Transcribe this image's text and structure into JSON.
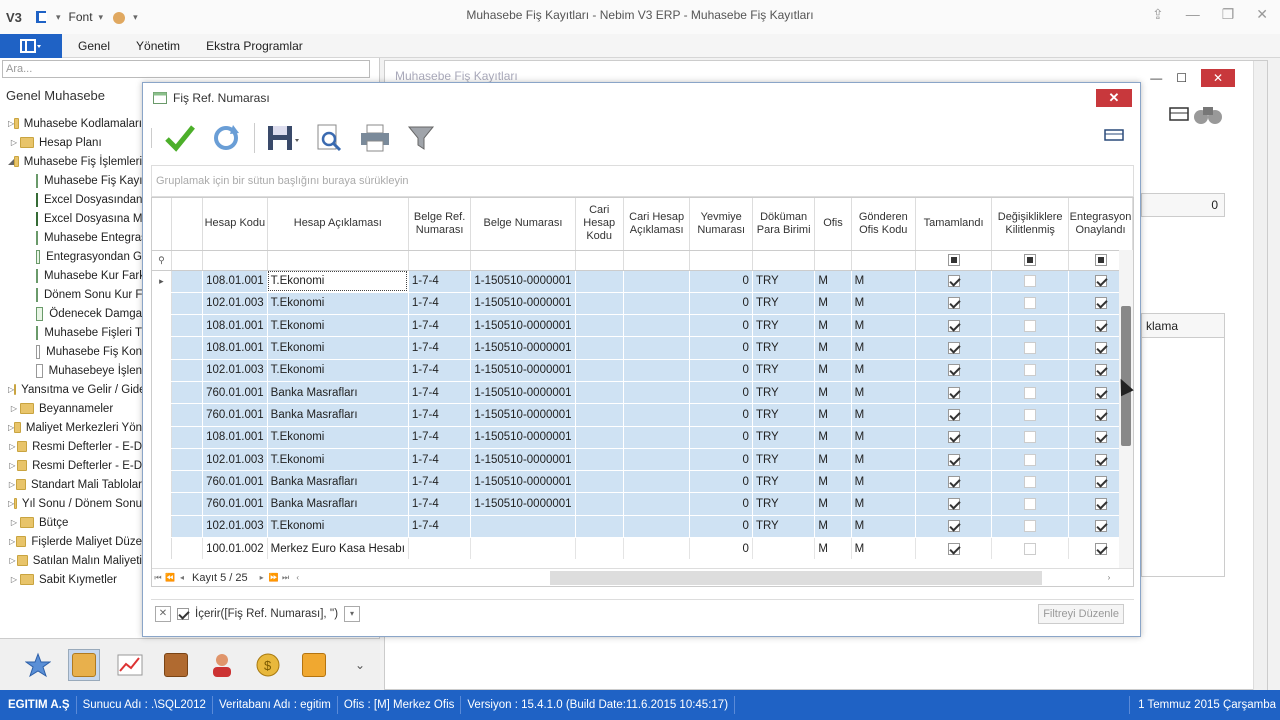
{
  "window": {
    "title": "Muhasebe Fiş Kayıtları - Nebim V3 ERP - Muhasebe Fiş Kayıtları",
    "logo": "V3",
    "quick_access_font": "Font"
  },
  "menu": {
    "items": [
      "Genel",
      "Yönetim",
      "Ekstra Programlar"
    ]
  },
  "sidebar": {
    "search_placeholder": "Ara...",
    "header": "Genel Muhasebe",
    "tree": [
      {
        "label": "Muhasebe Kodlamaları",
        "type": "folder",
        "level": 0,
        "expanded": false
      },
      {
        "label": "Hesap Planı",
        "type": "folder",
        "level": 0,
        "expanded": false
      },
      {
        "label": "Muhasebe Fiş İşlemleri",
        "type": "folder",
        "level": 0,
        "expanded": true
      },
      {
        "label": "Muhasebe Fiş Kayıtları",
        "type": "doc",
        "level": 1
      },
      {
        "label": "Excel Dosyasından",
        "type": "xls",
        "level": 1
      },
      {
        "label": "Excel Dosyasına M",
        "type": "xls",
        "level": 1
      },
      {
        "label": "Muhasebe Entegrasyon",
        "type": "doc",
        "level": 1
      },
      {
        "label": "Entegrasyondan G",
        "type": "doc",
        "level": 1
      },
      {
        "label": "Muhasebe Kur Fark",
        "type": "doc",
        "level": 1
      },
      {
        "label": "Dönem Sonu Kur F",
        "type": "doc",
        "level": 1
      },
      {
        "label": "Ödenecek Damga",
        "type": "doc",
        "level": 1
      },
      {
        "label": "Muhasebe Fişleri T",
        "type": "doc",
        "level": 1
      },
      {
        "label": "Muhasebe Fiş Kon",
        "type": "plain",
        "level": 1
      },
      {
        "label": "Muhasebeye İşlen",
        "type": "plain",
        "level": 1
      },
      {
        "label": "Yansıtma ve Gelir / Gider",
        "type": "folder",
        "level": 0,
        "expanded": false
      },
      {
        "label": "Beyannameler",
        "type": "folder",
        "level": 0,
        "expanded": false
      },
      {
        "label": "Maliyet Merkezleri Yön",
        "type": "folder",
        "level": 0,
        "expanded": false
      },
      {
        "label": "Resmi Defterler - E-D",
        "type": "folder",
        "level": 0,
        "expanded": false
      },
      {
        "label": "Resmi Defterler - E-D",
        "type": "folder",
        "level": 0,
        "expanded": false
      },
      {
        "label": "Standart Mali Tablolar",
        "type": "folder",
        "level": 0,
        "expanded": false
      },
      {
        "label": "Yıl Sonu / Dönem Sonu",
        "type": "folder",
        "level": 0,
        "expanded": false
      },
      {
        "label": "Bütçe",
        "type": "folder",
        "level": 0,
        "expanded": false
      },
      {
        "label": "Fişlerde Maliyet Düze",
        "type": "folder",
        "level": 0,
        "expanded": false
      },
      {
        "label": "Satılan Malın Maliyeti",
        "type": "folder",
        "level": 0,
        "expanded": false
      },
      {
        "label": "Sabit Kıymetler",
        "type": "folder",
        "level": 0,
        "expanded": false
      }
    ]
  },
  "background_window": {
    "title": "Muhasebe Fiş Kayıtları",
    "panel_value": "0",
    "panel2_header": "klama"
  },
  "dialog": {
    "title": "Fiş Ref. Numarası",
    "group_hint": "Gruplamak için bir sütun başlığını buraya sürükleyin",
    "columns": [
      "Hesap Kodu",
      "Hesap Açıklaması",
      "Belge Ref. Numarası",
      "Belge Numarası",
      "Cari Hesap Kodu",
      "Cari Hesap Açıklaması",
      "Yevmiye Numarası",
      "Döküman Para Birimi",
      "Ofis",
      "Gönderen Ofis Kodu",
      "Tamamlandı",
      "Değişikliklere Kilitlenmiş",
      "Entegrasyon Onaylandı"
    ],
    "rows": [
      {
        "hesap_kodu": "108.01.001",
        "hesap_aciklamasi": "T.Ekonomi",
        "belge_ref": "1-7-4",
        "belge_no": "1-150510-0000001",
        "cari_kod": "",
        "cari_aciklama": "",
        "yevmiye": "0",
        "para_birimi": "TRY",
        "ofis": "M",
        "gonderen_ofis": "M",
        "tamamlandi": true,
        "kilitli": false,
        "onaylandi": true,
        "selected": true
      },
      {
        "hesap_kodu": "102.01.003",
        "hesap_aciklamasi": "T.Ekonomi",
        "belge_ref": "1-7-4",
        "belge_no": "1-150510-0000001",
        "cari_kod": "",
        "cari_aciklama": "",
        "yevmiye": "0",
        "para_birimi": "TRY",
        "ofis": "M",
        "gonderen_ofis": "M",
        "tamamlandi": true,
        "kilitli": false,
        "onaylandi": true,
        "selected": true
      },
      {
        "hesap_kodu": "108.01.001",
        "hesap_aciklamasi": "T.Ekonomi",
        "belge_ref": "1-7-4",
        "belge_no": "1-150510-0000001",
        "cari_kod": "",
        "cari_aciklama": "",
        "yevmiye": "0",
        "para_birimi": "TRY",
        "ofis": "M",
        "gonderen_ofis": "M",
        "tamamlandi": true,
        "kilitli": false,
        "onaylandi": true,
        "selected": true
      },
      {
        "hesap_kodu": "108.01.001",
        "hesap_aciklamasi": "T.Ekonomi",
        "belge_ref": "1-7-4",
        "belge_no": "1-150510-0000001",
        "cari_kod": "",
        "cari_aciklama": "",
        "yevmiye": "0",
        "para_birimi": "TRY",
        "ofis": "M",
        "gonderen_ofis": "M",
        "tamamlandi": true,
        "kilitli": false,
        "onaylandi": true,
        "selected": true
      },
      {
        "hesap_kodu": "102.01.003",
        "hesap_aciklamasi": "T.Ekonomi",
        "belge_ref": "1-7-4",
        "belge_no": "1-150510-0000001",
        "cari_kod": "",
        "cari_aciklama": "",
        "yevmiye": "0",
        "para_birimi": "TRY",
        "ofis": "M",
        "gonderen_ofis": "M",
        "tamamlandi": true,
        "kilitli": false,
        "onaylandi": true,
        "selected": true
      },
      {
        "hesap_kodu": "760.01.001",
        "hesap_aciklamasi": "Banka Masrafları",
        "belge_ref": "1-7-4",
        "belge_no": "1-150510-0000001",
        "cari_kod": "",
        "cari_aciklama": "",
        "yevmiye": "0",
        "para_birimi": "TRY",
        "ofis": "M",
        "gonderen_ofis": "M",
        "tamamlandi": true,
        "kilitli": false,
        "onaylandi": true,
        "selected": true
      },
      {
        "hesap_kodu": "760.01.001",
        "hesap_aciklamasi": "Banka Masrafları",
        "belge_ref": "1-7-4",
        "belge_no": "1-150510-0000001",
        "cari_kod": "",
        "cari_aciklama": "",
        "yevmiye": "0",
        "para_birimi": "TRY",
        "ofis": "M",
        "gonderen_ofis": "M",
        "tamamlandi": true,
        "kilitli": false,
        "onaylandi": true,
        "selected": true
      },
      {
        "hesap_kodu": "108.01.001",
        "hesap_aciklamasi": "T.Ekonomi",
        "belge_ref": "1-7-4",
        "belge_no": "1-150510-0000001",
        "cari_kod": "",
        "cari_aciklama": "",
        "yevmiye": "0",
        "para_birimi": "TRY",
        "ofis": "M",
        "gonderen_ofis": "M",
        "tamamlandi": true,
        "kilitli": false,
        "onaylandi": true,
        "selected": true
      },
      {
        "hesap_kodu": "102.01.003",
        "hesap_aciklamasi": "T.Ekonomi",
        "belge_ref": "1-7-4",
        "belge_no": "1-150510-0000001",
        "cari_kod": "",
        "cari_aciklama": "",
        "yevmiye": "0",
        "para_birimi": "TRY",
        "ofis": "M",
        "gonderen_ofis": "M",
        "tamamlandi": true,
        "kilitli": false,
        "onaylandi": true,
        "selected": true
      },
      {
        "hesap_kodu": "760.01.001",
        "hesap_aciklamasi": "Banka Masrafları",
        "belge_ref": "1-7-4",
        "belge_no": "1-150510-0000001",
        "cari_kod": "",
        "cari_aciklama": "",
        "yevmiye": "0",
        "para_birimi": "TRY",
        "ofis": "M",
        "gonderen_ofis": "M",
        "tamamlandi": true,
        "kilitli": false,
        "onaylandi": true,
        "selected": true
      },
      {
        "hesap_kodu": "760.01.001",
        "hesap_aciklamasi": "Banka Masrafları",
        "belge_ref": "1-7-4",
        "belge_no": "1-150510-0000001",
        "cari_kod": "",
        "cari_aciklama": "",
        "yevmiye": "0",
        "para_birimi": "TRY",
        "ofis": "M",
        "gonderen_ofis": "M",
        "tamamlandi": true,
        "kilitli": false,
        "onaylandi": true,
        "selected": true
      },
      {
        "hesap_kodu": "102.01.003",
        "hesap_aciklamasi": "T.Ekonomi",
        "belge_ref": "1-7-4",
        "belge_no": "",
        "cari_kod": "",
        "cari_aciklama": "",
        "yevmiye": "0",
        "para_birimi": "TRY",
        "ofis": "M",
        "gonderen_ofis": "M",
        "tamamlandi": true,
        "kilitli": false,
        "onaylandi": true,
        "selected": true
      },
      {
        "hesap_kodu": "100.01.002",
        "hesap_aciklamasi": "Merkez Euro Kasa Hesabı",
        "belge_ref": "",
        "belge_no": "",
        "cari_kod": "",
        "cari_aciklama": "",
        "yevmiye": "0",
        "para_birimi": "",
        "ofis": "M",
        "gonderen_ofis": "M",
        "tamamlandi": true,
        "kilitli": false,
        "onaylandi": true,
        "selected": false
      }
    ],
    "pager_text": "Kayıt 5 / 25",
    "filter_expression": "İçerir([Fiş Ref. Numarası], '')",
    "filter_edit_label": "Filtreyi Düzenle"
  },
  "statusbar": {
    "company": "EGITIM A.Ş",
    "server": "Sunucu Adı : .\\SQL2012",
    "database": "Veritabanı Adı : egitim",
    "office": "Ofis : [M]  Merkez Ofis",
    "version": "Versiyon : 15.4.1.0 (Build Date:11.6.2015 10:45:17)",
    "date": "1 Temmuz 2015 Çarşamba"
  },
  "colors": {
    "accent": "#1f62c5",
    "selection": "#cfe2f3",
    "close": "#c8383c"
  }
}
